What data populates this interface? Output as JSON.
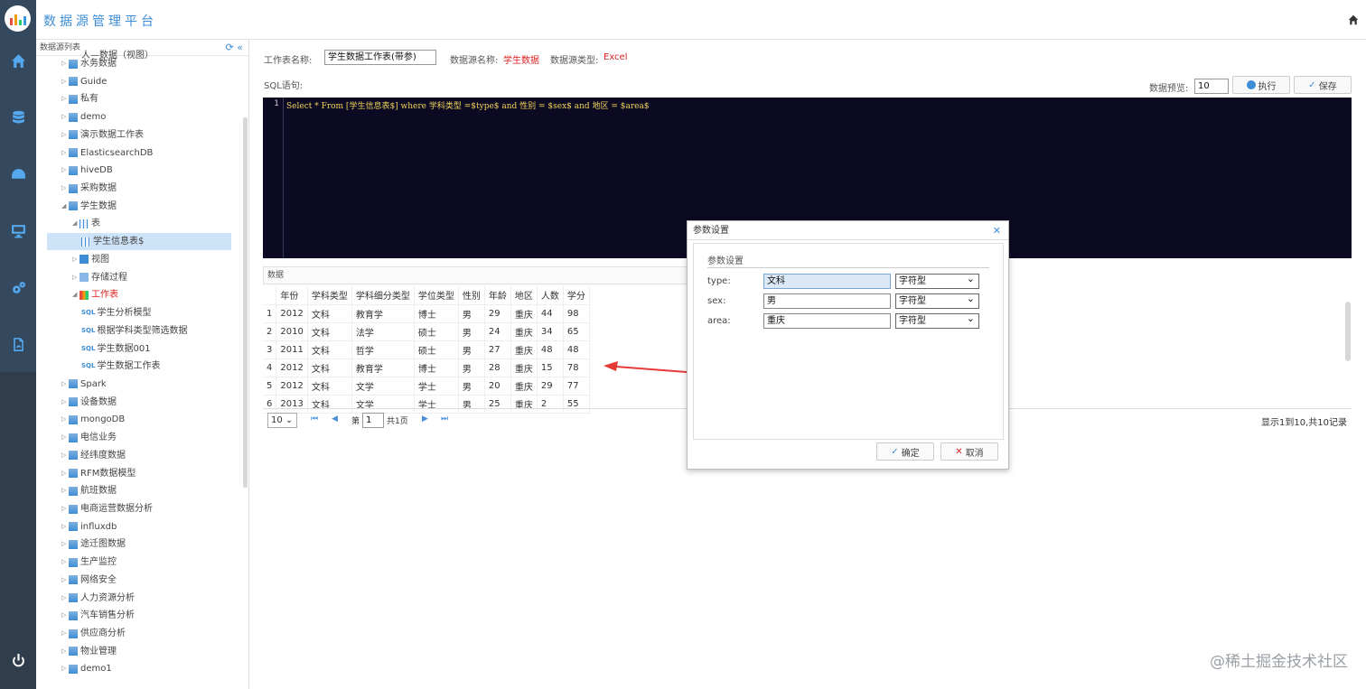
{
  "app": {
    "title": "数据源管理平台",
    "watermark": "@稀土掘金技术社区"
  },
  "rail": {
    "icons": [
      "home-icon",
      "database-icon",
      "dashboard-icon",
      "monitor-icon",
      "settings-icon",
      "pdf-icon",
      "power-icon"
    ]
  },
  "tree": {
    "header": "数据源列表",
    "top_partial": "人—数据（视图）",
    "items": [
      {
        "label": "水务数据",
        "level": 1
      },
      {
        "label": "Guide",
        "level": 1
      },
      {
        "label": "私有",
        "level": 1
      },
      {
        "label": "demo",
        "level": 1
      },
      {
        "label": "演示数据工作表",
        "level": 1
      },
      {
        "label": "ElasticsearchDB",
        "level": 1
      },
      {
        "label": "hiveDB",
        "level": 1
      },
      {
        "label": "采购数据",
        "level": 1
      },
      {
        "label": "学生数据",
        "level": 1,
        "expanded": true
      },
      {
        "label": "表",
        "level": 2,
        "expanded": true
      },
      {
        "label": "学生信息表$",
        "level": 3,
        "selected": true
      },
      {
        "label": "视图",
        "level": 2
      },
      {
        "label": "存储过程",
        "level": 2
      },
      {
        "label": "工作表",
        "level": 2,
        "expanded": true,
        "highlight": true
      },
      {
        "label": "学生分析模型",
        "level": 3
      },
      {
        "label": "根据学科类型筛选数据",
        "level": 3
      },
      {
        "label": "学生数据001",
        "level": 3
      },
      {
        "label": "学生数据工作表",
        "level": 3
      },
      {
        "label": "Spark",
        "level": 1
      },
      {
        "label": "设备数据",
        "level": 1
      },
      {
        "label": "mongoDB",
        "level": 1
      },
      {
        "label": "电信业务",
        "level": 1
      },
      {
        "label": "经纬度数据",
        "level": 1
      },
      {
        "label": "RFM数据模型",
        "level": 1
      },
      {
        "label": "航班数据",
        "level": 1
      },
      {
        "label": "电商运营数据分析",
        "level": 1
      },
      {
        "label": "influxdb",
        "level": 1
      },
      {
        "label": "途迁图数据",
        "level": 1
      },
      {
        "label": "生产监控",
        "level": 1
      },
      {
        "label": "网络安全",
        "level": 1
      },
      {
        "label": "人力资源分析",
        "level": 1
      },
      {
        "label": "汽车销售分析",
        "level": 1
      },
      {
        "label": "供应商分析",
        "level": 1
      },
      {
        "label": "物业管理",
        "level": 1
      },
      {
        "label": "demo1",
        "level": 1
      }
    ],
    "sql_tag": "SQL"
  },
  "sheet": {
    "name_label": "工作表名称:",
    "name_value": "学生数据工作表(带参)",
    "ds_name_label": "数据源名称:",
    "ds_name_value": "学生数据",
    "ds_type_label": "数据源类型:",
    "ds_type_value": "Excel",
    "sql_label": "SQL语句:",
    "preview_label": "数据预览:",
    "preview_value": "10",
    "run_label": "执行",
    "save_label": "保存"
  },
  "editor": {
    "line_no": "1",
    "code": "Select * From [学生信息表$] where 学科类型 =$type$ and 性别 = $sex$ and 地区 = $area$"
  },
  "data": {
    "header": "数据",
    "columns": [
      "年份",
      "学科类型",
      "学科细分类型",
      "学位类型",
      "性别",
      "年龄",
      "地区",
      "人数",
      "学分"
    ],
    "rows": [
      [
        "1",
        "2012",
        "文科",
        "教育学",
        "博士",
        "男",
        "29",
        "重庆",
        "44",
        "98"
      ],
      [
        "2",
        "2010",
        "文科",
        "法学",
        "硕士",
        "男",
        "24",
        "重庆",
        "34",
        "65"
      ],
      [
        "3",
        "2011",
        "文科",
        "哲学",
        "硕士",
        "男",
        "27",
        "重庆",
        "48",
        "48"
      ],
      [
        "4",
        "2012",
        "文科",
        "教育学",
        "博士",
        "男",
        "28",
        "重庆",
        "15",
        "78"
      ],
      [
        "5",
        "2012",
        "文科",
        "文学",
        "学士",
        "男",
        "20",
        "重庆",
        "29",
        "77"
      ],
      [
        "6",
        "2013",
        "文科",
        "文学",
        "学士",
        "男",
        "25",
        "重庆",
        "2",
        "55"
      ]
    ],
    "pager": {
      "page_size": "10",
      "page_prefix": "第",
      "page_value": "1",
      "page_total": "共1页",
      "summary": "显示1到10,共10记录"
    }
  },
  "dialog": {
    "title": "参数设置",
    "legend": "参数设置",
    "params": [
      {
        "label": "type:",
        "value": "文科",
        "type": "字符型"
      },
      {
        "label": "sex:",
        "value": "男",
        "type": "字符型"
      },
      {
        "label": "area:",
        "value": "重庆",
        "type": "字符型"
      }
    ],
    "ok_label": "确定",
    "cancel_label": "取消"
  },
  "colors": {
    "accent": "#3c8dd5",
    "rail": "#34495e",
    "editor_bg": "#0c0a22",
    "code": "#f0d35a",
    "red": "#dd2222"
  }
}
